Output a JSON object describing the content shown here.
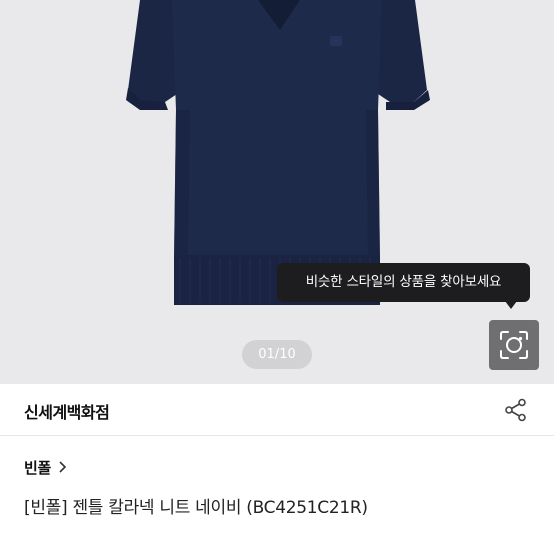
{
  "gallery": {
    "tooltip_text": "비슷한 스타일의 상품을 찾아보세요",
    "page_indicator": "01/10",
    "background_color": "#e9e9eb",
    "garment_color": "#1e2a4a",
    "image_search_icon": "camera-scan-icon"
  },
  "seller": {
    "name": "신세계백화점",
    "share_icon": "share-icon"
  },
  "product": {
    "brand": "빈폴",
    "brand_chevron_icon": "chevron-right-icon",
    "title": "[빈폴] 젠틀 칼라넥 니트 네이비 (BC4251C21R)"
  }
}
